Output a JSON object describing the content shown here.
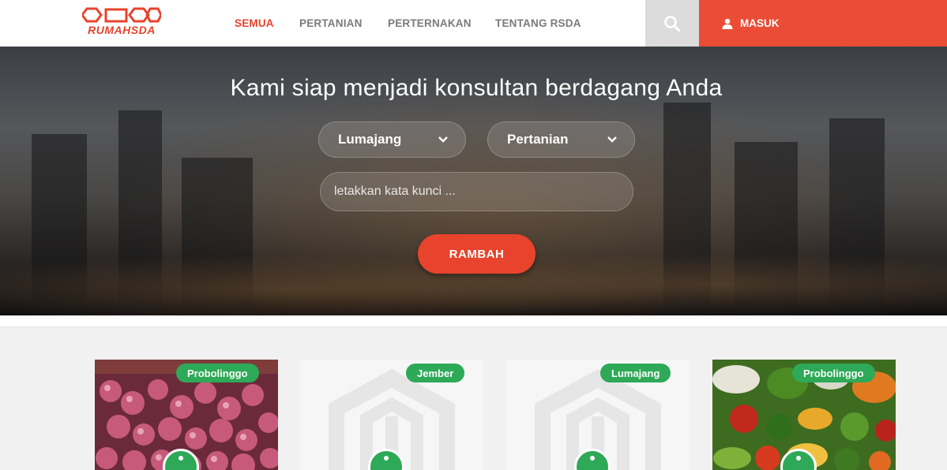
{
  "brand": {
    "name": "RUMAHSDA",
    "color": "#e8432c"
  },
  "nav": {
    "items": [
      {
        "label": "SEMUA",
        "active": true
      },
      {
        "label": "PERTANIAN",
        "active": false
      },
      {
        "label": "PERTERNAKAN",
        "active": false
      },
      {
        "label": "TENTANG RSDA",
        "active": false
      }
    ],
    "search_icon": "search-icon",
    "login_label": "MASUK",
    "login_icon": "user-icon"
  },
  "hero": {
    "title": "Kami siap menjadi konsultan berdagang Anda",
    "location_select": "Lumajang",
    "category_select": "Pertanian",
    "keyword_placeholder": "letakkan kata kunci ...",
    "search_button": "RAMBAH"
  },
  "products": [
    {
      "location": "Probolinggo",
      "image": "shallots-photo"
    },
    {
      "location": "Jember",
      "image": "placeholder-logo"
    },
    {
      "location": "Lumajang",
      "image": "placeholder-logo"
    },
    {
      "location": "Probolinggo",
      "image": "vegetables-photo"
    }
  ],
  "colors": {
    "accent": "#e8432c",
    "badge": "#2ea957",
    "login_bg": "#ea4c36"
  }
}
